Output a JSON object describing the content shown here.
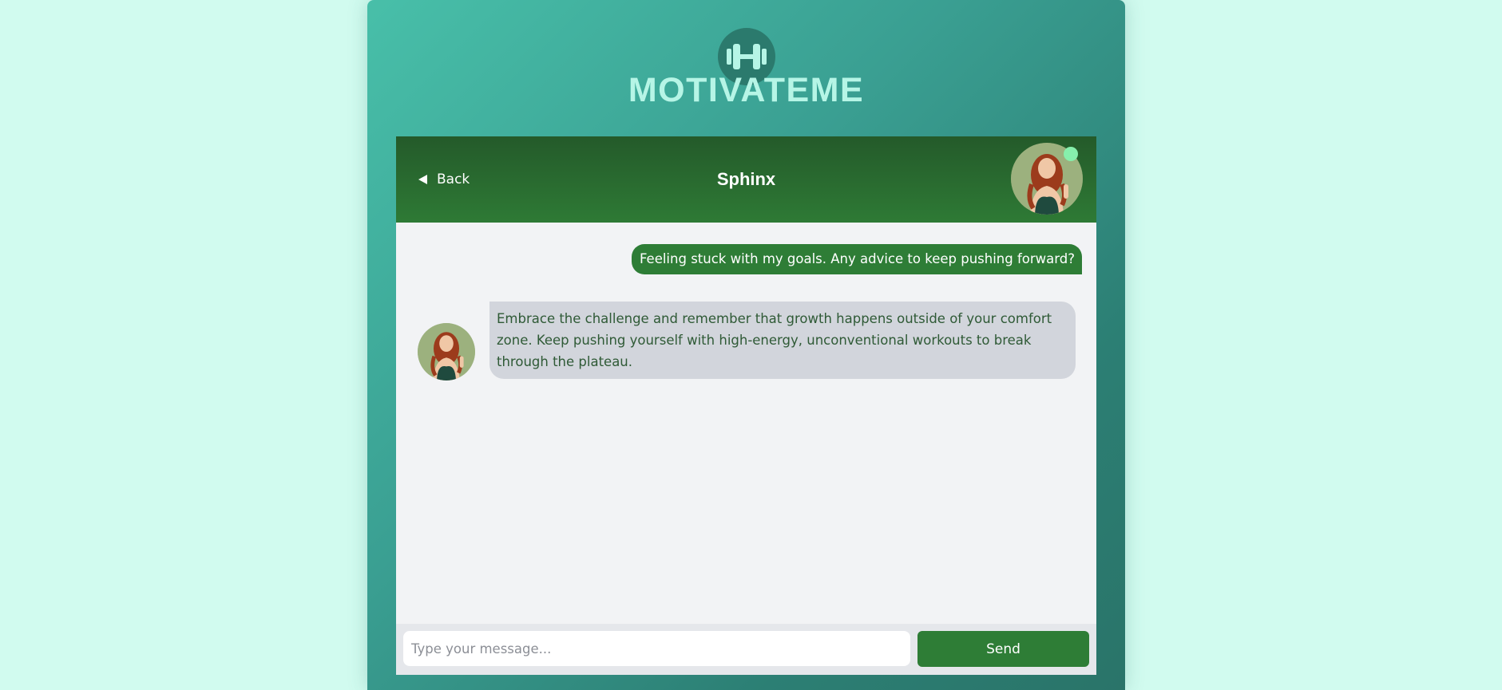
{
  "brand": {
    "name": "MOTIVATEME",
    "logo_icon": "dumbbell-icon"
  },
  "chat": {
    "back_label": "Back",
    "title": "Sphinx",
    "status": "online"
  },
  "messages": [
    {
      "sender": "user",
      "text": "Feeling stuck with my goals. Any advice to keep pushing forward?"
    },
    {
      "sender": "bot",
      "text": "Embrace the challenge and remember that growth happens outside of your comfort zone. Keep pushing yourself with high-energy, unconventional workouts to break through the plateau."
    }
  ],
  "composer": {
    "placeholder": "Type your message...",
    "value": "",
    "send_label": "Send"
  },
  "colors": {
    "page_bg": "#d1fbef",
    "header_green": "#2e7a35",
    "accent_green": "#2e7d36",
    "online": "#86efac",
    "logo_text": "#b6f5e6"
  }
}
